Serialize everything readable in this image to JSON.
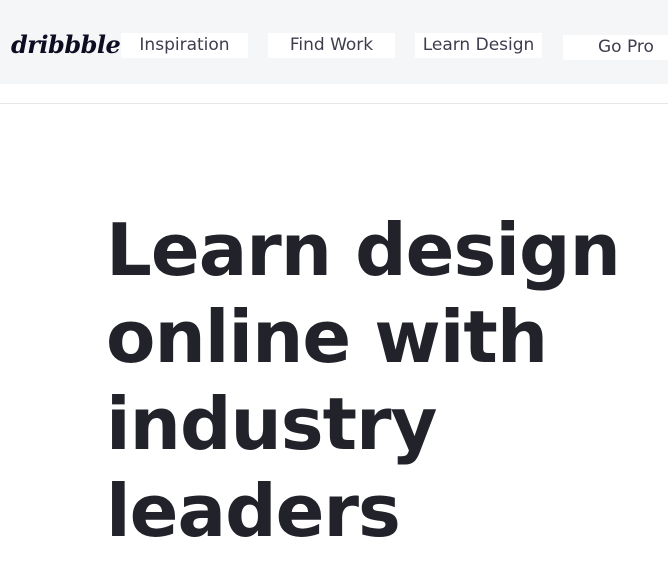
{
  "header": {
    "logo_text": "dribbble",
    "nav": [
      {
        "label": "Inspiration"
      },
      {
        "label": "Find Work"
      },
      {
        "label": "Learn Design"
      },
      {
        "label": "Go Pro"
      }
    ]
  },
  "hero": {
    "title_lines": [
      "Learn design",
      "online with",
      "industry",
      "leaders"
    ]
  },
  "colors": {
    "header_bg": "#f5f6f8",
    "text_dark": "#22232a",
    "nav_text": "#3d3d4e"
  }
}
